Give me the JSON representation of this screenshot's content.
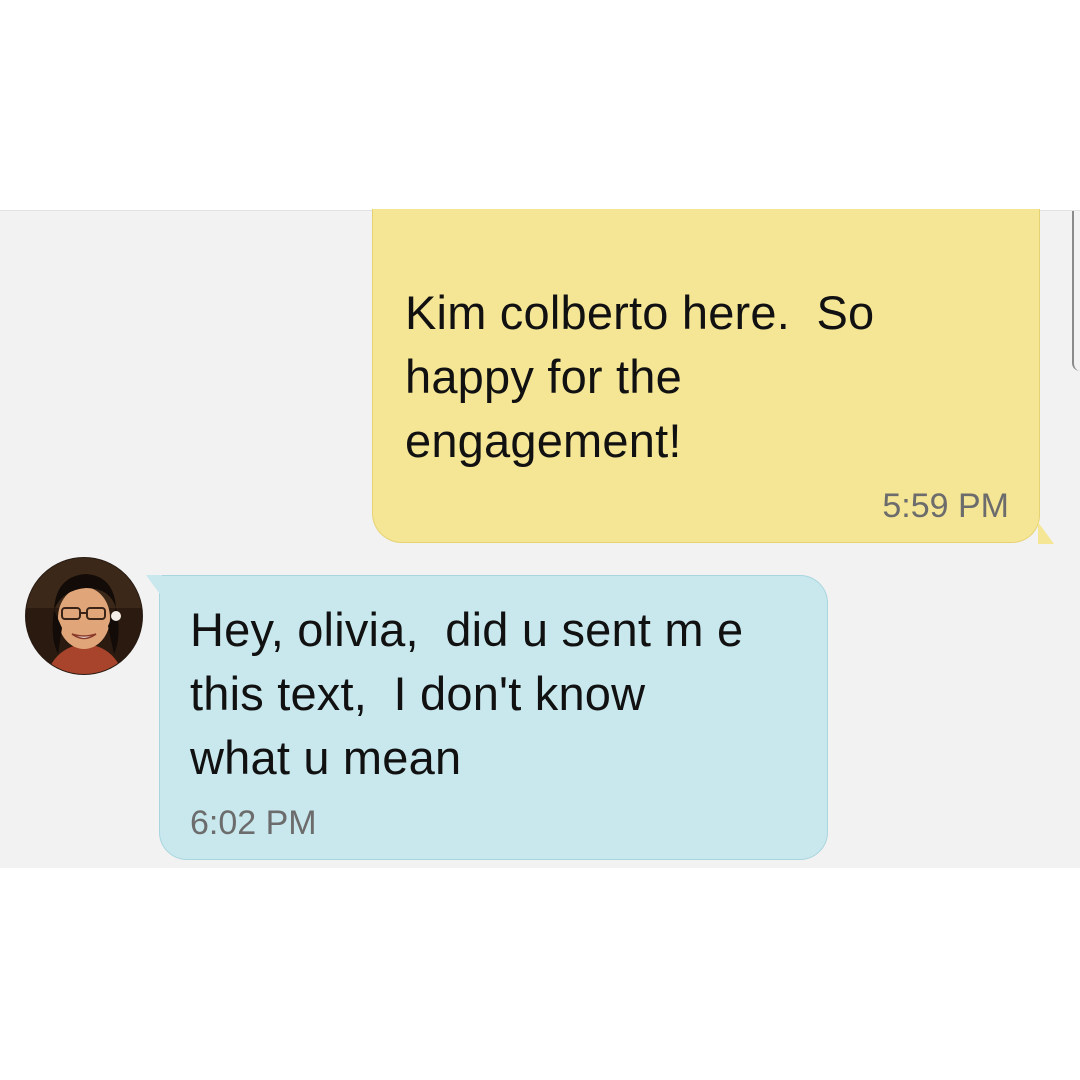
{
  "conversation": {
    "messages": [
      {
        "direction": "outgoing",
        "text": "Kim colberto here.  So\nhappy for the\nengagement!",
        "time": "5:59 PM"
      },
      {
        "direction": "incoming",
        "text": "Hey, olivia,  did u sent m e\nthis text,  I don't know\nwhat u mean",
        "time": "6:02 PM"
      }
    ]
  },
  "colors": {
    "outgoing_bubble": "#f5e696",
    "incoming_bubble": "#c8e8ee",
    "chat_background": "#f2f2f2",
    "timestamp": "#6c6c6c"
  },
  "icons": {
    "avatar": "contact-photo"
  }
}
